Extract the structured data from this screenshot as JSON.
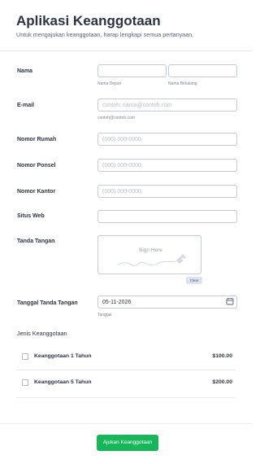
{
  "header": {
    "title": "Aplikasi Keanggotaan",
    "subtitle": "Untuk mengajukan keanggotaan, harap lengkapi semua pertanyaan."
  },
  "fields": {
    "name": {
      "label": "Nama",
      "first_sub": "Nama Depan",
      "last_sub": "Nama Belakang"
    },
    "email": {
      "label": "E-mail",
      "placeholder": "contoh: nama@contoh.com",
      "sub": "contoh@contoh.com"
    },
    "home_phone": {
      "label": "Nomor Rumah",
      "placeholder": "(000) 000-0000"
    },
    "mobile_phone": {
      "label": "Nomor Ponsel",
      "placeholder": "(000) 000-0000"
    },
    "office_phone": {
      "label": "Nomor Kantor",
      "placeholder": "(000) 000-0000"
    },
    "website": {
      "label": "Situs Web",
      "placeholder": ""
    },
    "signature": {
      "label": "Tanda Tangan",
      "hint": "Sign Here",
      "clear_label": "Clear"
    },
    "sign_date": {
      "label": "Tanggal Tanda Tangan",
      "value": "05-11-2026",
      "sub": "Tanggal"
    }
  },
  "membership": {
    "label": "Jenis Keanggotaan",
    "items": [
      {
        "name": "Keanggotaan 1 Tahun",
        "price": "$100.00",
        "checked": false
      },
      {
        "name": "Keanggotaan 5 Tahun",
        "price": "$200.00",
        "checked": false
      }
    ]
  },
  "submit": {
    "label": "Ajukan Keanggotaan"
  },
  "colors": {
    "accent": "#18b65b",
    "text": "#2c3345",
    "border": "#c3cad8"
  }
}
